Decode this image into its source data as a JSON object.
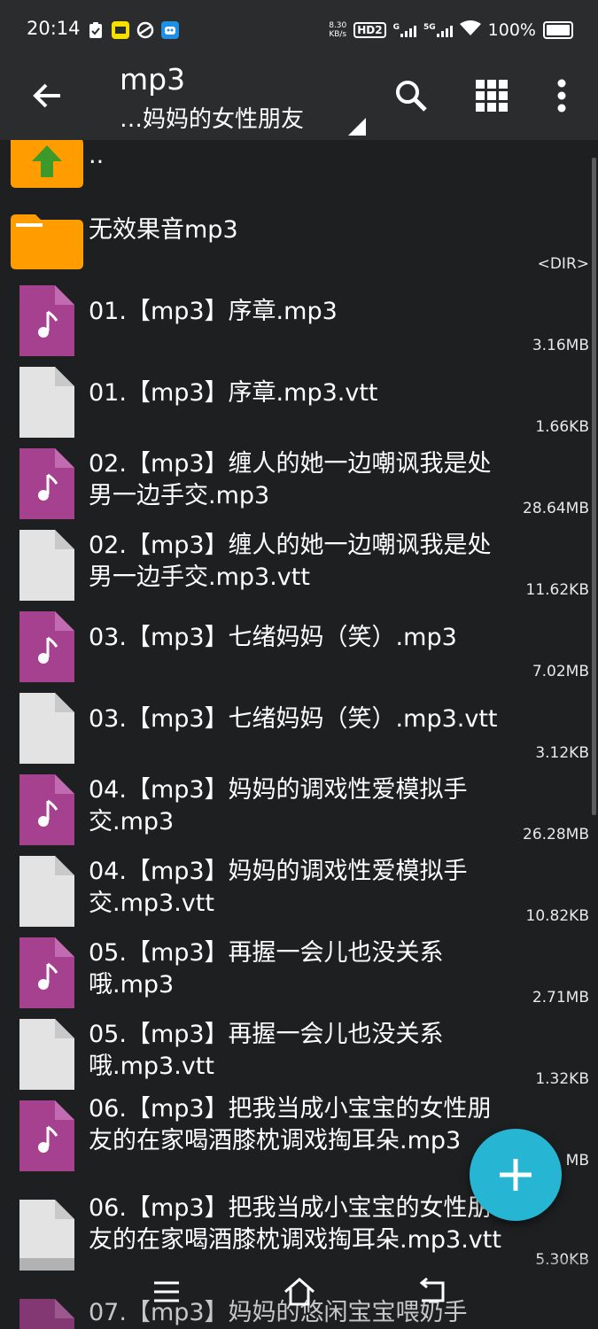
{
  "status_bar": {
    "time": "20:14",
    "net_speed_value": "8.30",
    "net_speed_unit": "KB/s",
    "hd_badge": "HD2",
    "signal1_label": "G",
    "signal2_label": "5G",
    "battery_text": "100%",
    "icons": [
      "clipboard-check-icon",
      "vip-app-icon",
      "swirl-app-icon",
      "robot-app-icon",
      "wifi-icon",
      "battery-icon"
    ]
  },
  "toolbar": {
    "title": "mp3",
    "subtitle": "…妈妈的女性朋友",
    "icons": [
      "back-arrow-icon",
      "search-icon",
      "grid-view-icon",
      "more-vert-icon"
    ]
  },
  "files": [
    {
      "name": "..",
      "meta": "",
      "type": "parent"
    },
    {
      "name": "无效果音mp3",
      "meta": "<DIR>",
      "type": "folder"
    },
    {
      "name": "01.【mp3】序章.mp3",
      "meta": "3.16MB",
      "type": "audio"
    },
    {
      "name": "01.【mp3】序章.mp3.vtt",
      "meta": "1.66KB",
      "type": "doc"
    },
    {
      "name": "02.【mp3】缠人的她一边嘲讽我是处男一边手交.mp3",
      "meta": "28.64MB",
      "type": "audio"
    },
    {
      "name": "02.【mp3】缠人的她一边嘲讽我是处男一边手交.mp3.vtt",
      "meta": "11.62KB",
      "type": "doc"
    },
    {
      "name": "03.【mp3】七绪妈妈（笑）.mp3",
      "meta": "7.02MB",
      "type": "audio"
    },
    {
      "name": "03.【mp3】七绪妈妈（笑）.mp3.vtt",
      "meta": "3.12KB",
      "type": "doc"
    },
    {
      "name": "04.【mp3】妈妈的调戏性爱模拟手交.mp3",
      "meta": "26.28MB",
      "type": "audio"
    },
    {
      "name": "04.【mp3】妈妈的调戏性爱模拟手交.mp3.vtt",
      "meta": "10.82KB",
      "type": "doc"
    },
    {
      "name": "05.【mp3】再握一会儿也没关系哦.mp3",
      "meta": "2.71MB",
      "type": "audio"
    },
    {
      "name": "05.【mp3】再握一会儿也没关系哦.mp3.vtt",
      "meta": "1.32KB",
      "type": "doc"
    },
    {
      "name": "06.【mp3】把我当成小宝宝的女性朋友的在家喝酒膝枕调戏掏耳朵.mp3",
      "meta": "MB",
      "type": "audio"
    },
    {
      "name": "06.【mp3】把我当成小宝宝的女性朋友的在家喝酒膝枕调戏掏耳朵.mp3.vtt",
      "meta": "5.30KB",
      "type": "doc"
    },
    {
      "name": "07.【mp3】妈妈的悠闲宝宝喂奶手",
      "meta": "",
      "type": "audio"
    }
  ],
  "fab": {
    "icon": "plus-icon"
  },
  "nav_bar": {
    "icons": [
      "menu-icon",
      "home-icon",
      "back-icon"
    ]
  },
  "colors": {
    "audio": "#a5418f",
    "doc": "#e3e3e3",
    "folder": "#ff9d00",
    "accent": "#26b6d4"
  }
}
